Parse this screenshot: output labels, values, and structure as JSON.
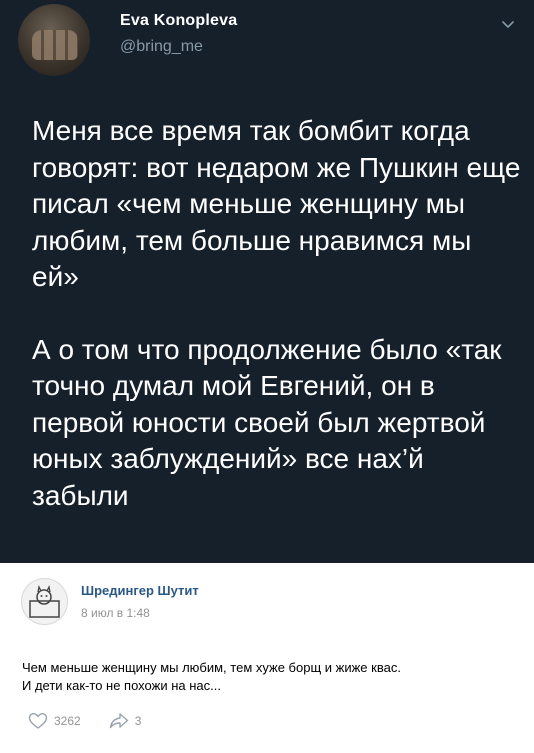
{
  "tweet": {
    "author_name": "Eva Konopleva",
    "author_handle": "@bring_me",
    "paragraph_1": "Меня все время так бомбит когда говорят: вот недаром же Пушкин еще писал «чем меньше женщину мы любим, тем больше нравимся мы ей»",
    "paragraph_2": "А о том что продолжение было «так точно думал мой Евгений, он в первой юности своей был жертвой юных заблуждений» все нах’й забыли",
    "menu_icon": "chevron-down-icon"
  },
  "vk_post": {
    "author_name": "Шредингер Шутит",
    "timestamp": "8 июл в 1:48",
    "text_line_1": "Чем меньше женщину мы любим, тем хуже борщ и жиже квас.",
    "text_line_2": "И дети как-то не похожи на нас...",
    "likes_count": "3262",
    "shares_count": "3",
    "like_icon": "heart-icon",
    "share_icon": "share-arrow-icon"
  },
  "colors": {
    "tweet_background": "#15202b",
    "tweet_text": "#ffffff",
    "handle": "#8899a6",
    "vk_link": "#2a5885",
    "vk_meta": "#939393"
  }
}
